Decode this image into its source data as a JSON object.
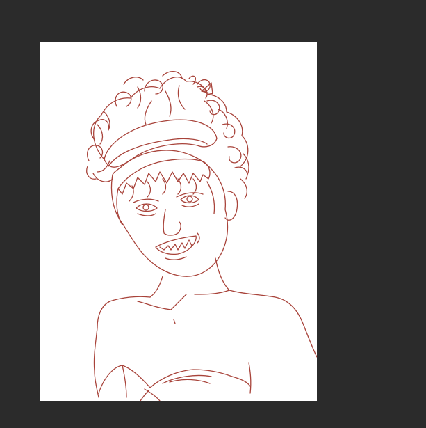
{
  "app": {
    "workspace_color": "#2b2b2b",
    "canvas_color": "#ffffff"
  },
  "artwork": {
    "subject": "line-art-portrait-sketch",
    "stroke_color": "#a8433a"
  }
}
